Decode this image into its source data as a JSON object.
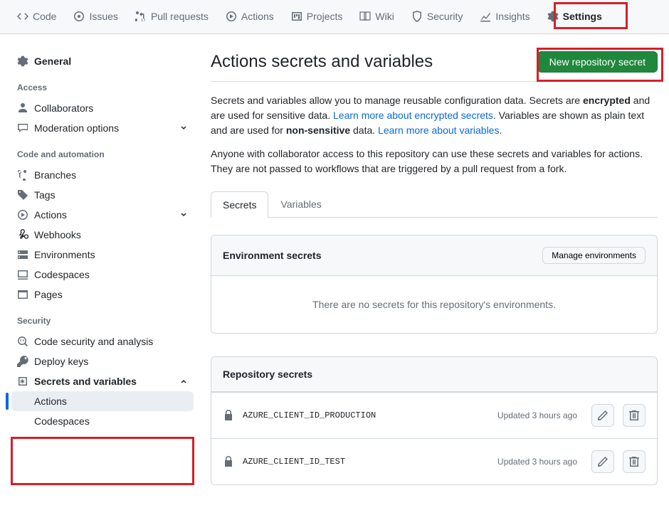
{
  "topnav": {
    "items": [
      {
        "label": "Code"
      },
      {
        "label": "Issues"
      },
      {
        "label": "Pull requests"
      },
      {
        "label": "Actions"
      },
      {
        "label": "Projects"
      },
      {
        "label": "Wiki"
      },
      {
        "label": "Security"
      },
      {
        "label": "Insights"
      },
      {
        "label": "Settings"
      }
    ]
  },
  "sidebar": {
    "general": "General",
    "access_heading": "Access",
    "access": [
      {
        "label": "Collaborators"
      },
      {
        "label": "Moderation options"
      }
    ],
    "code_heading": "Code and automation",
    "code": [
      {
        "label": "Branches"
      },
      {
        "label": "Tags"
      },
      {
        "label": "Actions"
      },
      {
        "label": "Webhooks"
      },
      {
        "label": "Environments"
      },
      {
        "label": "Codespaces"
      },
      {
        "label": "Pages"
      }
    ],
    "security_heading": "Security",
    "security": [
      {
        "label": "Code security and analysis"
      },
      {
        "label": "Deploy keys"
      },
      {
        "label": "Secrets and variables"
      }
    ],
    "secrets_sub": [
      {
        "label": "Actions"
      },
      {
        "label": "Codespaces"
      }
    ]
  },
  "main": {
    "title": "Actions secrets and variables",
    "new_secret_btn": "New repository secret",
    "desc1_a": "Secrets and variables allow you to manage reusable configuration data. Secrets are ",
    "desc1_b": "encrypted",
    "desc1_c": " and are used for sensitive data. ",
    "link1": "Learn more about encrypted secrets",
    "desc1_d": ". Variables are shown as plain text and are used for ",
    "desc1_e": "non-sensitive",
    "desc1_f": " data. ",
    "link2": "Learn more about variables",
    "desc1_g": ".",
    "desc2": "Anyone with collaborator access to this repository can use these secrets and variables for actions. They are not passed to workflows that are triggered by a pull request from a fork.",
    "tabs": {
      "secrets": "Secrets",
      "variables": "Variables"
    },
    "env_secrets": {
      "title": "Environment secrets",
      "manage_btn": "Manage environments",
      "empty": "There are no secrets for this repository's environments."
    },
    "repo_secrets": {
      "title": "Repository secrets",
      "rows": [
        {
          "name": "AZURE_CLIENT_ID_PRODUCTION",
          "updated": "Updated 3 hours ago"
        },
        {
          "name": "AZURE_CLIENT_ID_TEST",
          "updated": "Updated 3 hours ago"
        }
      ]
    }
  }
}
